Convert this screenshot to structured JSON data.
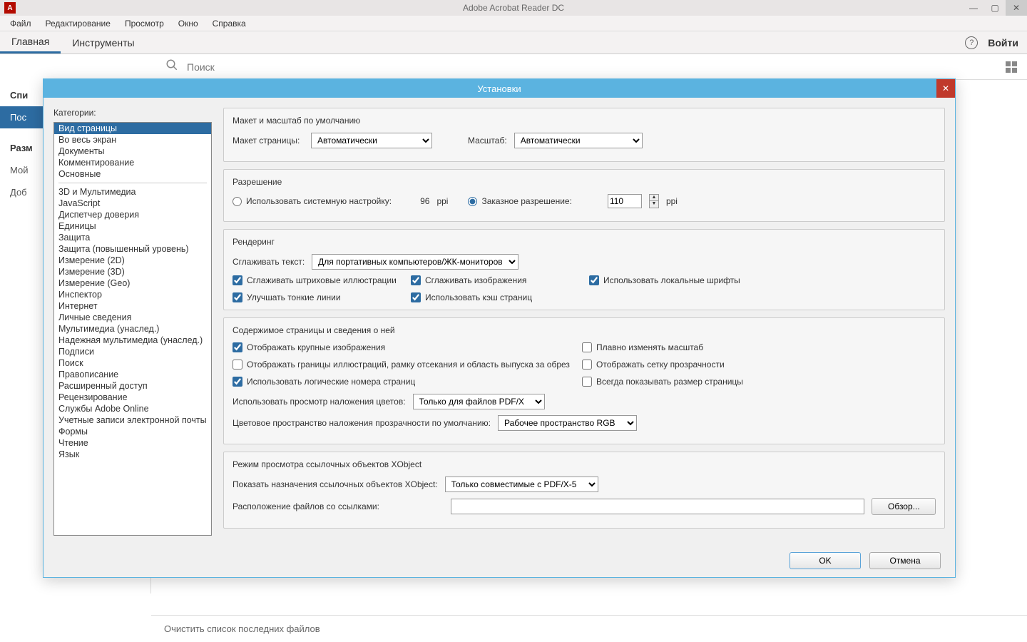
{
  "titlebar": {
    "title": "Adobe Acrobat Reader DC"
  },
  "menu": {
    "items": [
      "Файл",
      "Редактирование",
      "Просмотр",
      "Окно",
      "Справка"
    ]
  },
  "tabs": {
    "main": "Главная",
    "tools": "Инструменты",
    "login": "Войти"
  },
  "search": {
    "placeholder": "Поиск"
  },
  "leftnav": {
    "items": [
      "Спи",
      "Пос",
      "Разм",
      "Мой",
      "Доб"
    ]
  },
  "footer": {
    "clear": "Очистить список последних файлов"
  },
  "dialog": {
    "title": "Установки",
    "categories_label": "Категории:",
    "categories_group1": [
      "Вид страницы",
      "Во весь экран",
      "Документы",
      "Комментирование",
      "Основные"
    ],
    "categories_group2": [
      "3D и Мультимедиа",
      "JavaScript",
      "Диспетчер доверия",
      "Единицы",
      "Защита",
      "Защита (повышенный уровень)",
      "Измерение (2D)",
      "Измерение (3D)",
      "Измерение (Geo)",
      "Инспектор",
      "Интернет",
      "Личные сведения",
      "Мультимедиа (унаслед.)",
      "Надежная мультимедиа (унаслед.)",
      "Подписи",
      "Поиск",
      "Правописание",
      "Расширенный доступ",
      "Рецензирование",
      "Службы Adobe Online",
      "Учетные записи электронной почты",
      "Формы",
      "Чтение",
      "Язык"
    ],
    "layout": {
      "group_title": "Макет и масштаб по умолчанию",
      "page_layout_label": "Макет страницы:",
      "page_layout_value": "Автоматически",
      "zoom_label": "Масштаб:",
      "zoom_value": "Автоматически"
    },
    "resolution": {
      "group_title": "Разрешение",
      "system_label": "Использовать системную настройку:",
      "system_value": "96",
      "unit": "ppi",
      "custom_label": "Заказное разрешение:",
      "custom_value": "110"
    },
    "rendering": {
      "group_title": "Рендеринг",
      "smooth_text_label": "Сглаживать текст:",
      "smooth_text_value": "Для портативных компьютеров/ЖК-мониторов",
      "c1": "Сглаживать штриховые иллюстрации",
      "c2": "Сглаживать изображения",
      "c3": "Использовать локальные шрифты",
      "c4": "Улучшать тонкие линии",
      "c5": "Использовать кэш страниц"
    },
    "content": {
      "group_title": "Содержимое страницы и сведения о ней",
      "c1": "Отображать крупные изображения",
      "c2": "Плавно изменять масштаб",
      "c3": "Отображать границы иллюстраций, рамку отсекания и область выпуска за обрез",
      "c4": "Отображать сетку прозрачности",
      "c5": "Использовать логические номера страниц",
      "c6": "Всегда показывать размер страницы",
      "overprint_label": "Использовать просмотр наложения цветов:",
      "overprint_value": "Только для файлов PDF/X",
      "colorspace_label": "Цветовое пространство наложения прозрачности по умолчанию:",
      "colorspace_value": "Рабочее пространство RGB"
    },
    "xobject": {
      "group_title": "Режим просмотра ссылочных объектов XObject",
      "target_label": "Показать назначения ссылочных объектов XObject:",
      "target_value": "Только совместимые с PDF/X-5",
      "location_label": "Расположение файлов со ссылками:",
      "browse": "Обзор..."
    },
    "buttons": {
      "ok": "OK",
      "cancel": "Отмена"
    }
  }
}
